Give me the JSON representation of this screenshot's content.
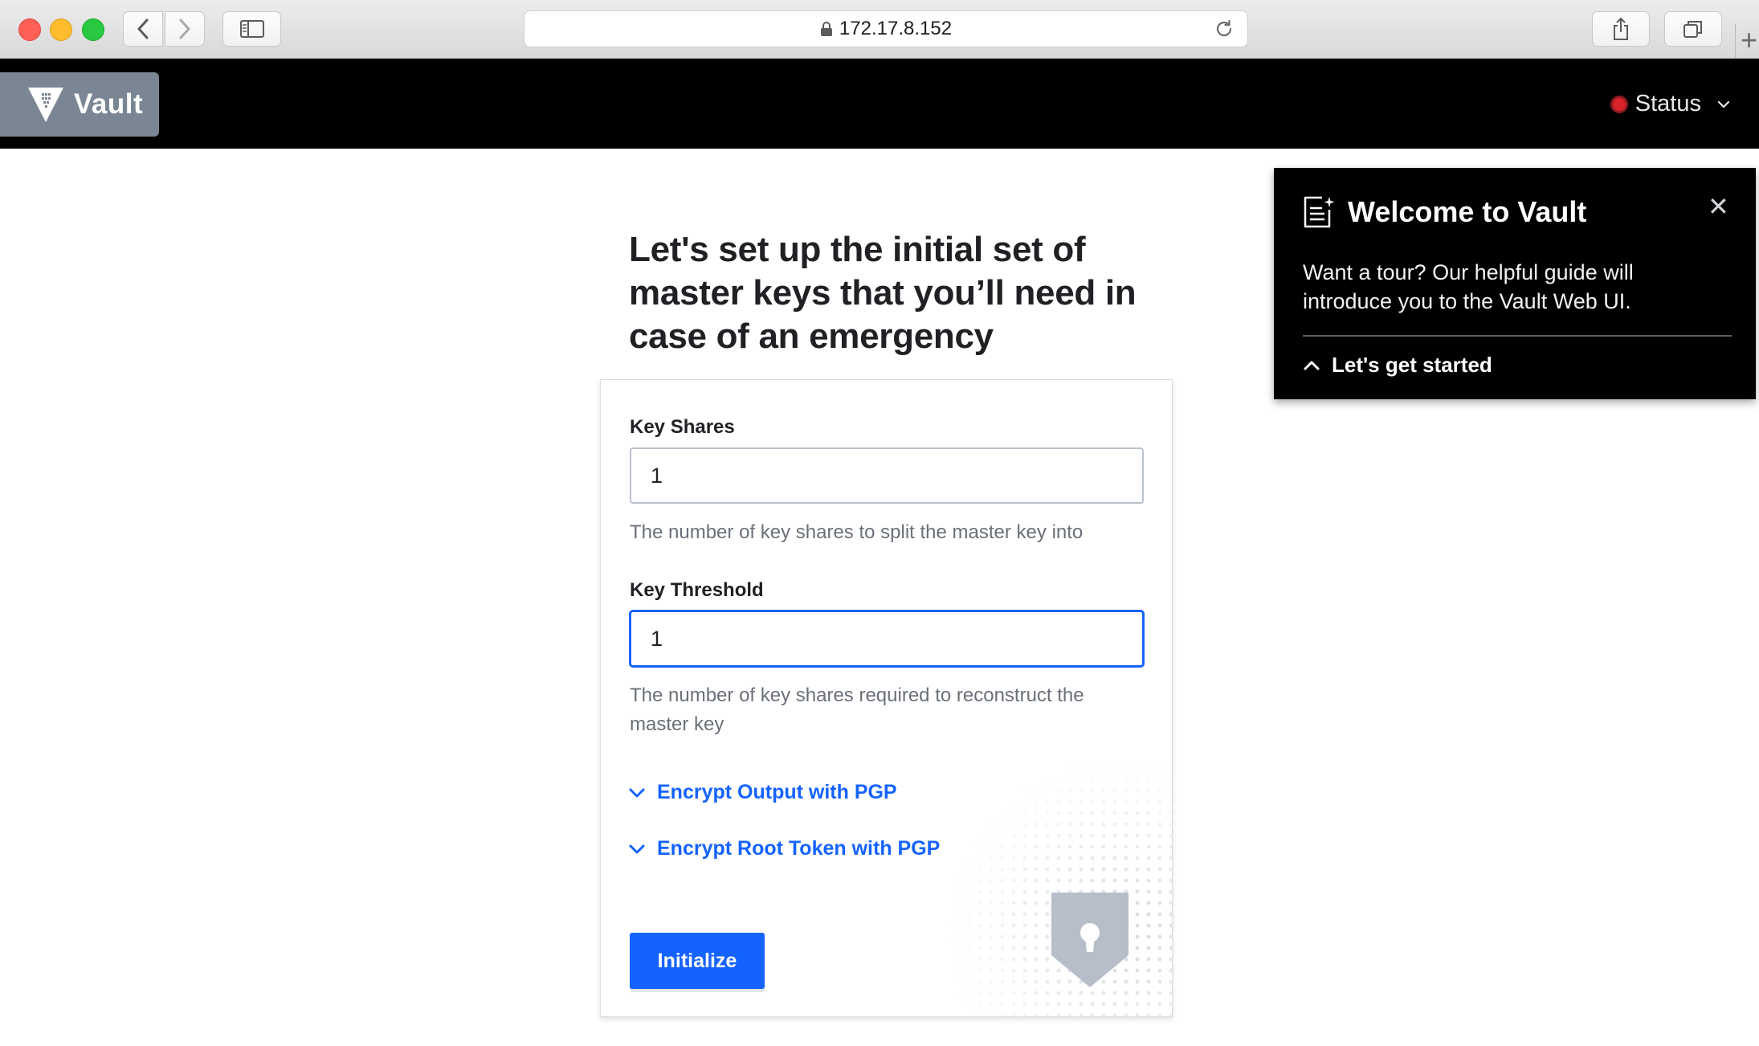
{
  "browser": {
    "url": "172.17.8.152",
    "new_tab_label": "+"
  },
  "header": {
    "logo_text": "Vault",
    "status_label": "Status",
    "status_color": "#d8232a"
  },
  "main": {
    "title": "Let's set up the initial set of master keys that you’ll need in case of an emergency",
    "key_shares": {
      "label": "Key Shares",
      "value": "1",
      "help": "The number of key shares to split the master key into"
    },
    "key_threshold": {
      "label": "Key Threshold",
      "value": "1",
      "help": "The number of key shares required to reconstruct the master key"
    },
    "toggles": [
      {
        "label": "Encrypt Output with PGP"
      },
      {
        "label": "Encrypt Root Token with PGP"
      }
    ],
    "submit_label": "Initialize"
  },
  "welcome": {
    "title": "Welcome to Vault",
    "close_label": "✕",
    "body": "Want a tour? Our helpful guide will introduce you to the Vault Web UI.",
    "cta": "Let's get started"
  },
  "colors": {
    "accent": "#1563ff",
    "header_bg": "#000000",
    "logo_bg": "#7b8694"
  },
  "icons": [
    "back-arrow-icon",
    "forward-arrow-icon",
    "sidebar-icon",
    "lock-icon",
    "reload-icon",
    "share-icon",
    "tabs-icon",
    "vault-logo-icon",
    "chevron-down-icon",
    "chevron-up-icon",
    "close-icon",
    "guide-icon",
    "shield-keyhole-icon"
  ]
}
